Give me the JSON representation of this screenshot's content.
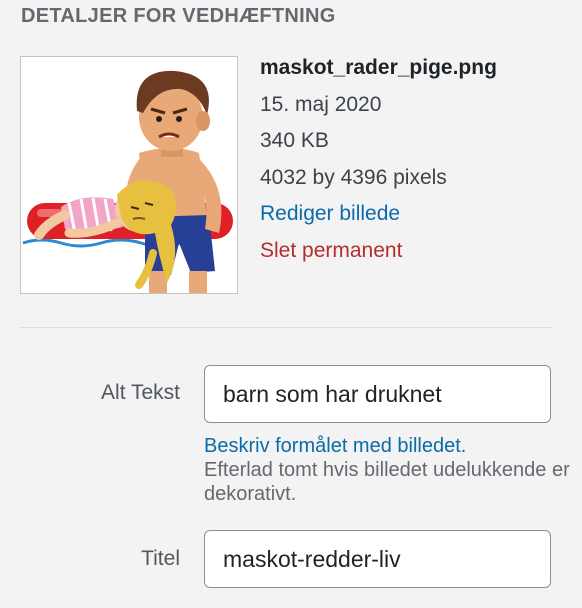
{
  "section": {
    "title": "DETALJER FOR VEDHÆFTNING"
  },
  "attachment": {
    "filename": "maskot_rader_pige.png",
    "date": "15. maj 2020",
    "size": "340 KB",
    "dimensions": "4032 by 4396 pixels",
    "edit_link": "Rediger billede",
    "delete_link": "Slet permanent"
  },
  "fields": {
    "alt": {
      "label": "Alt Tekst",
      "value": "barn som har druknet"
    },
    "alt_help": {
      "link": "Beskriv formålet med billedet.",
      "text": "Efterlad tomt hvis billedet udelukkende er dekorativt."
    },
    "title": {
      "label": "Titel",
      "value": "maskot-redder-liv"
    }
  },
  "colors": {
    "link": "#0a6ba8",
    "delete": "#b32d2e",
    "background": "#f3f3f4"
  }
}
